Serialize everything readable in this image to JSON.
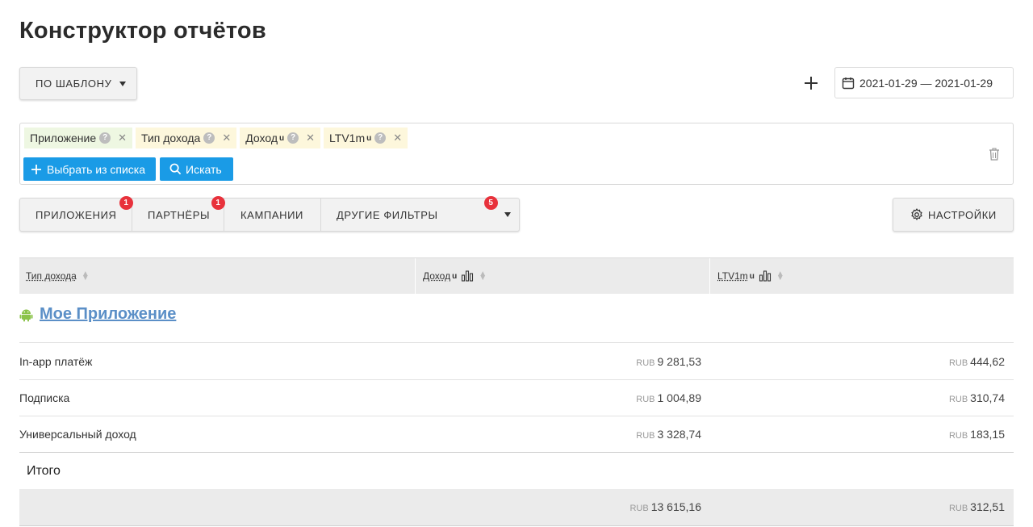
{
  "page": {
    "title": "Конструктор отчётов"
  },
  "toolbar": {
    "template_label": "ПО ШАБЛОНУ",
    "date_range": "2021-01-29 — 2021-01-29"
  },
  "filter_box": {
    "chips": [
      {
        "label": "Приложение",
        "marker": "",
        "color": "green"
      },
      {
        "label": "Тип дохода",
        "marker": "",
        "color": "yellow"
      },
      {
        "label": "Доход",
        "marker": "u",
        "color": "yellow"
      },
      {
        "label": "LTV1m",
        "marker": "u",
        "color": "yellow"
      }
    ],
    "select_label": "Выбрать из списка",
    "search_label": "Искать"
  },
  "filter_tabs": [
    {
      "label": "ПРИЛОЖЕНИЯ",
      "badge": "1"
    },
    {
      "label": "ПАРТНЁРЫ",
      "badge": "1"
    },
    {
      "label": "КАМПАНИИ",
      "badge": ""
    },
    {
      "label": "ДРУГИЕ ФИЛЬТРЫ",
      "badge": "5"
    }
  ],
  "settings_label": "НАСТРОЙКИ",
  "table": {
    "columns": [
      {
        "label": "Тип дохода",
        "marker": ""
      },
      {
        "label": "Доход",
        "marker": "u"
      },
      {
        "label": "LTV1m",
        "marker": "u"
      }
    ],
    "group": {
      "app_name": "Мое Приложение"
    },
    "rows": [
      {
        "type": "In-app платёж",
        "income_currency": "RUB",
        "income": "9 281,53",
        "ltv_currency": "RUB",
        "ltv": "444,62"
      },
      {
        "type": "Подписка",
        "income_currency": "RUB",
        "income": "1 004,89",
        "ltv_currency": "RUB",
        "ltv": "310,74"
      },
      {
        "type": "Универсальный доход",
        "income_currency": "RUB",
        "income": "3 328,74",
        "ltv_currency": "RUB",
        "ltv": "183,15"
      }
    ],
    "total_label": "Итого",
    "total": {
      "income_currency": "RUB",
      "income": "13 615,16",
      "ltv_currency": "RUB",
      "ltv": "312,51"
    }
  },
  "colors": {
    "accent_blue": "#1a9be6",
    "badge_red": "#e8323c",
    "link_blue": "#5b8fc7",
    "android_green": "#8bc34a"
  }
}
